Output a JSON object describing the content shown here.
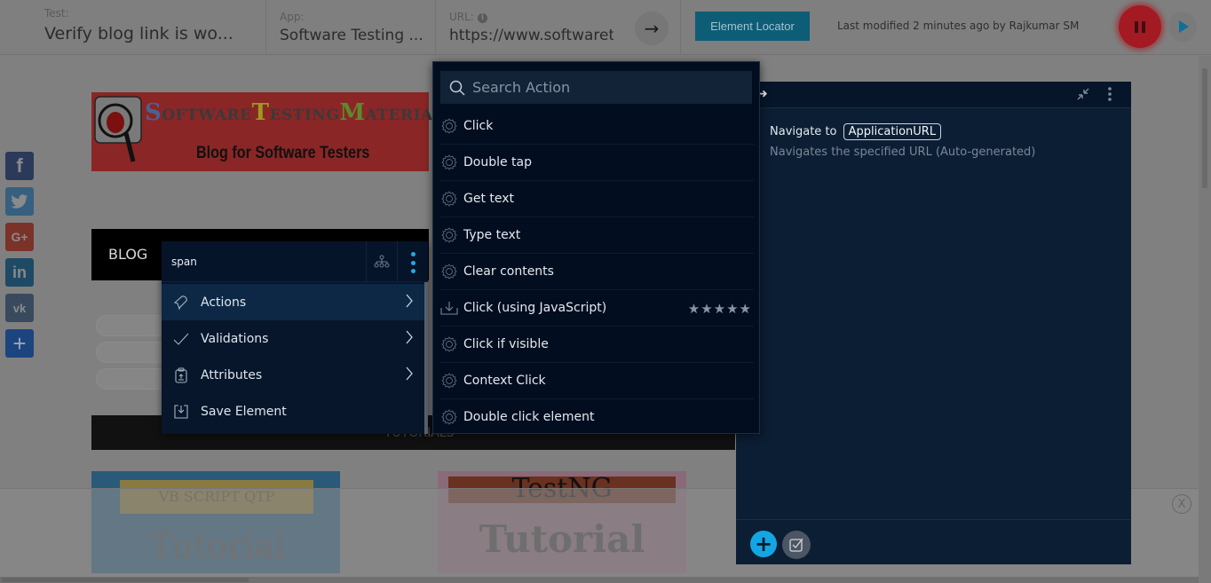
{
  "header": {
    "test_label": "Test:",
    "test_value": "Verify blog link is wo...",
    "app_label": "App:",
    "app_value": "Software Testing ...",
    "url_label": "URL:",
    "url_info_icon": "info-icon",
    "url_value": "https://www.softwaretestingmaterial.com",
    "go_icon": "arrow-right-icon",
    "element_locator_label": "Element Locator",
    "last_modified": "Last modified 2 minutes ago by Rajkumar SM",
    "pause_icon": "pause-icon",
    "play_icon": "play-icon",
    "colors": {
      "accent": "#0e5d76",
      "record": "#a41a22",
      "play": "#0f6f94"
    }
  },
  "page": {
    "logo": {
      "title_parts": [
        "S",
        "OFTWARE",
        "T",
        "ESTING",
        "M",
        "ATERIAL"
      ],
      "subtitle": "Blog for Software Testers"
    },
    "social": [
      "facebook-icon",
      "twitter-icon",
      "google-plus-icon",
      "linkedin-icon",
      "vk-icon",
      "share-add-icon"
    ],
    "social_glyphs": [
      "f",
      "🐦",
      "G+",
      "in",
      "vk",
      "+"
    ],
    "blog_label": "BLOG",
    "tutorials_label": "TUTORIALS",
    "tiles": [
      {
        "banner": "VB SCRIPT  QTP",
        "text": "Tutorial"
      },
      {
        "banner": "TestNG",
        "text": "Tutorial"
      }
    ],
    "close_label": "X"
  },
  "context_menu": {
    "title": "span",
    "tree_icon": "dom-tree-icon",
    "more_icon": "more-vertical-icon",
    "items": [
      {
        "label": "Actions",
        "icon": "pointer-icon",
        "has_submenu": true,
        "active": true
      },
      {
        "label": "Validations",
        "icon": "check-icon",
        "has_submenu": true,
        "active": false
      },
      {
        "label": "Attributes",
        "icon": "clipboard-icon",
        "has_submenu": true,
        "active": false
      },
      {
        "label": "Save Element",
        "icon": "save-icon",
        "has_submenu": false,
        "active": false
      }
    ]
  },
  "actions_menu": {
    "search_placeholder": "Search Action",
    "search_value": "",
    "items": [
      {
        "label": "Click",
        "icon": "gear-icon"
      },
      {
        "label": "Double tap",
        "icon": "gear-icon"
      },
      {
        "label": "Get text",
        "icon": "gear-icon"
      },
      {
        "label": "Type text",
        "icon": "gear-icon"
      },
      {
        "label": "Clear contents",
        "icon": "gear-icon"
      },
      {
        "label": "Click (using JavaScript)",
        "icon": "download-icon",
        "rating": 5,
        "rating_max": 5
      },
      {
        "label": "Click if visible",
        "icon": "gear-icon"
      },
      {
        "label": "Context Click",
        "icon": "gear-icon"
      },
      {
        "label": "Double click element",
        "icon": "gear-icon"
      }
    ]
  },
  "step_panel": {
    "collapse_icon": "collapse-icon",
    "more_icon": "more-vertical-icon",
    "step": {
      "action": "Navigate to",
      "param": "ApplicationURL",
      "description": "Navigates the specified URL (Auto-generated)"
    },
    "add_icon": "plus-icon",
    "checkpoint_icon": "checkbox-icon"
  }
}
